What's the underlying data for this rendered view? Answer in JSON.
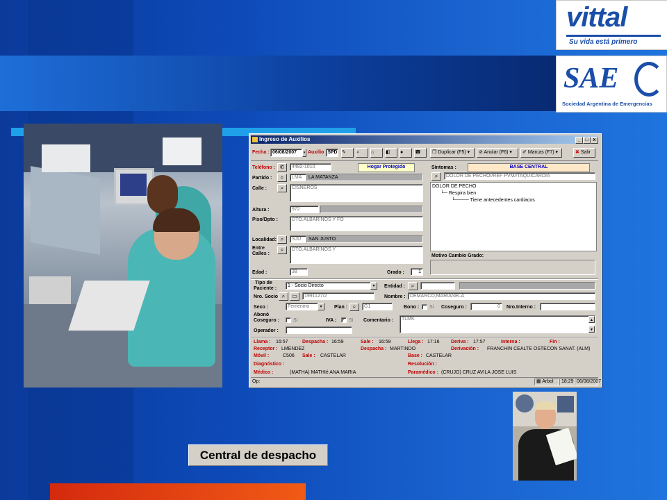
{
  "logos": {
    "vittal_name": "vittal",
    "vittal_slogan": "Su vida está primero",
    "sae_name": "SAE",
    "sae_subtitle": "Sociedad Argentina de Emergencias"
  },
  "caption": "Central de despacho",
  "window": {
    "title": "Ingreso de Auxilios",
    "controls": [
      "_",
      "□",
      "x"
    ],
    "toolbar": {
      "fecha_label": "Fecha :",
      "fecha_value": "06/08/2007",
      "auxilio_label": "Auxilio :",
      "auxilio_value": "5PD",
      "duplicar": "Duplicar (F5)",
      "anular": "Anular (F6)",
      "marcas": "Marcas (F7)",
      "salir": "Salir"
    },
    "left": {
      "telefono_label": "Teléfono :",
      "telefono_value": "4482-1010",
      "hogar_badge": "Hogar Protegido",
      "partido_label": "Partido :",
      "partido_code": "LMA",
      "partido_name": "LA MATANZA",
      "calle_label": "Calle :",
      "calle_value": "CISNEROS",
      "altura_label": "Altura :",
      "altura_value": "972",
      "piso_label": "Piso/Dpto :",
      "piso_value": "DTO.ALBARIÑOS Y FO",
      "localidad_label": "Localidad:",
      "localidad_code": "SJU",
      "localidad_name": "SAN JUSTO",
      "entre_label_1": "Entre",
      "entre_label_2": "Calles :",
      "entre_value": "DTO.ALBARIÑOS Y",
      "edad_label": "Edad :",
      "edad_value": "38",
      "grado_label": "Grado :",
      "grado_value": "1"
    },
    "right": {
      "sintomas_label": "Síntomas :",
      "base_badge": "BASE CENTRAL",
      "sintoma_value": "DOLOR DE PECHO//REF PVM//TAQUICARDIA",
      "tree": [
        "DOLOR DE PECHO",
        "Respira bien",
        "Tiene antecedentes cardiacos"
      ],
      "motivo_label": "Motivo Cambio Grado:"
    },
    "patient": {
      "tipo_label_1": "Tipo de",
      "tipo_label_2": "Paciente :",
      "tipo_value": "1 - Socio Directo",
      "entidad_label": "Entidad :",
      "nro_socio_label": "Nro. Socio :",
      "nro_socio_value": "1991127/2",
      "nombre_label": "Nombre :",
      "nombre_value": "DEMARCO,MARIANELA",
      "sexo_label": "Sexo :",
      "sexo_value": "Femenino",
      "plan_label": "Plan :",
      "plan_value": "G1",
      "bono_label": "Bono :",
      "bono_si": "Si",
      "coseguro_label": "Coseguro :",
      "coseguro_value": "0",
      "nro_interno_label": "Nro.Interno :",
      "abono_label_1": "Abonó",
      "abono_label_2": "Coseguro :",
      "abono_si": "Si",
      "iva_label": "IVA :",
      "iva_si": "Si",
      "comentario_label": "Comentario :",
      "comentario_value": "TLMK",
      "operador_label": "Operador :"
    },
    "times": {
      "llama_label": "Llama :",
      "llama_value": "16:57",
      "despacha_label": "Despacha :",
      "despacha_value": "16:59",
      "sale_label": "Sale :",
      "sale_value": "16:59",
      "llega_label": "Llega :",
      "llega_value": "17:16",
      "deriva_label": "Deriva :",
      "deriva_value": "17:57",
      "interna_label": "Interna :",
      "fin_label": "Fin :",
      "receptor_label": "Receptor :",
      "receptor_value": "LMENDEZ",
      "despacha2_label": "Despacha :",
      "despacha2_value": "MARTINDO",
      "derivacion_label": "Derivación :",
      "derivacion_value": "FRANCHIN CEALTE OSTECON SANAT. (ALM)",
      "movil_label": "Móvil :",
      "movil_value": "C506",
      "sale2_label": "Sale :",
      "sale2_value": "CASTELAR",
      "base_label": "Base :",
      "base_value": "CASTELAR",
      "diagnostico_label": "Diagnóstico :",
      "resolucion_label": "Resolución :",
      "medico_label": "Médico :",
      "medico_value": "(MATHA) MATHIé ANA MARIA",
      "paramedico_label": "Paramédico :",
      "paramedico_value": "(CRUJO) CRUZ AVILA JOSE LUIS"
    },
    "status": {
      "op_label": "Op:",
      "arbol": "Arbol",
      "time": "18:29",
      "date": "06/08/2007"
    }
  }
}
